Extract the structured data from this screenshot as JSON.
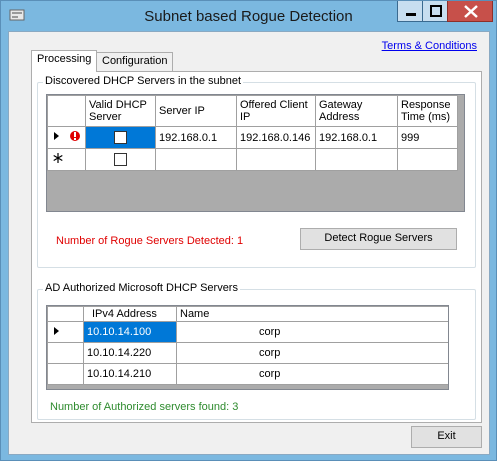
{
  "window": {
    "title": "Subnet based Rogue Detection"
  },
  "links": {
    "terms": "Terms & Conditions"
  },
  "tabs": [
    {
      "label": "Processing"
    },
    {
      "label": "Configuration"
    }
  ],
  "discovered": {
    "title": "Discovered DHCP Servers in the subnet",
    "columns": [
      "Valid DHCP Server",
      "Server IP",
      "Offered Client IP",
      "Gateway Address",
      "Response Time (ms)"
    ],
    "rows": [
      {
        "valid": false,
        "server_ip": "192.168.0.1",
        "offered_ip": "192.168.0.146",
        "gateway": "192.168.0.1",
        "response": "999"
      }
    ],
    "rogue_count_text": "Number of Rogue Servers Detected: 1",
    "detect_button": "Detect Rogue Servers"
  },
  "authorized": {
    "title": "AD Authorized Microsoft DHCP Servers",
    "columns": [
      "IPv4 Address",
      "Name"
    ],
    "rows": [
      {
        "ip": "10.10.14.100",
        "name": "corp"
      },
      {
        "ip": "10.10.14.220",
        "name": "corp"
      },
      {
        "ip": "10.10.14.210",
        "name": "corp"
      }
    ],
    "count_text": "Number of Authorized servers found: 3"
  },
  "exit_button": "Exit",
  "colors": {
    "title_bar": "#7bb8e0",
    "selected_cell": "#0078d7",
    "rogue_text": "#e00000",
    "authorized_text": "#2e8b2e",
    "link": "#0000ee"
  }
}
